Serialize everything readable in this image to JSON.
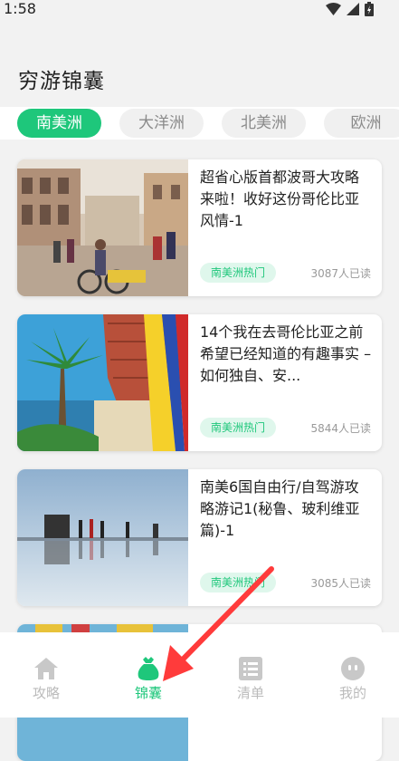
{
  "status": {
    "time": "1:58"
  },
  "page": {
    "title": "穷游锦囊"
  },
  "tabs": [
    {
      "label": "南美洲",
      "active": true
    },
    {
      "label": "大洋洲",
      "active": false
    },
    {
      "label": "北美洲",
      "active": false
    },
    {
      "label": "欧洲",
      "active": false
    }
  ],
  "articles": [
    {
      "title": "超省心版首都波哥大攻略来啦！收好这份哥伦比亚风情-1",
      "tag": "南美洲热门",
      "reads": "3087人已读"
    },
    {
      "title": "14个我在去哥伦比亚之前希望已经知道的有趣事实 – 如何独自、安...",
      "tag": "南美洲热门",
      "reads": "5844人已读"
    },
    {
      "title": "南美6国自由行/自驾游攻略游记1(秘鲁、玻利维亚篇)-1",
      "tag": "南美洲热门",
      "reads": "3085人已读"
    }
  ],
  "nav": [
    {
      "label": "攻略",
      "icon": "home-icon"
    },
    {
      "label": "锦囊",
      "icon": "bag-icon",
      "active": true
    },
    {
      "label": "清单",
      "icon": "list-icon"
    },
    {
      "label": "我的",
      "icon": "face-icon"
    }
  ],
  "colors": {
    "accent": "#1ec77b",
    "arrow": "#ff3b3b"
  }
}
